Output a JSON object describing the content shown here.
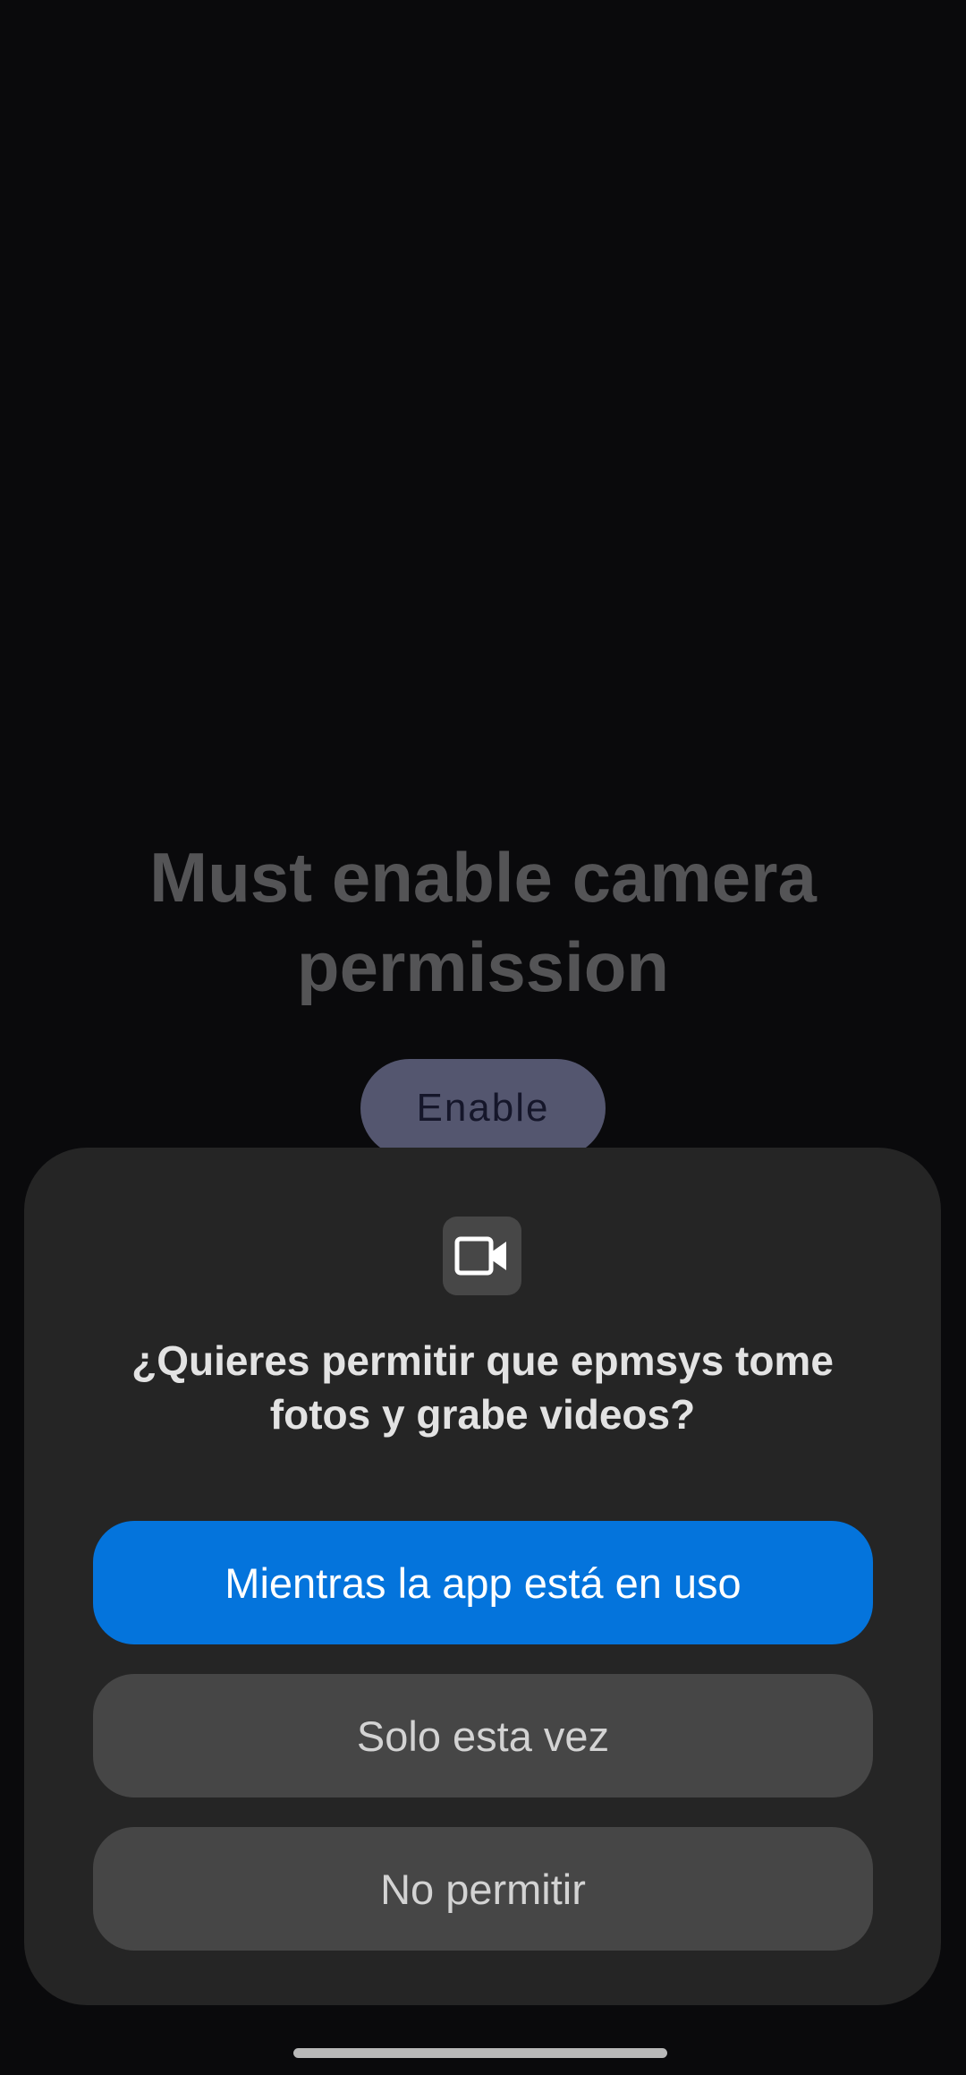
{
  "background": {
    "title": "Must enable camera permission",
    "enable_button": "Enable"
  },
  "dialog": {
    "icon": "video-camera-icon",
    "title": "¿Quieres permitir que epmsys tome fotos y grabe videos?",
    "buttons": {
      "while_in_use": "Mientras la app está en uso",
      "only_this_time": "Solo esta vez",
      "deny": "No permitir"
    }
  },
  "colors": {
    "primary_button": "#0474dc",
    "dialog_bg": "#252525",
    "secondary_button": "#464646"
  }
}
